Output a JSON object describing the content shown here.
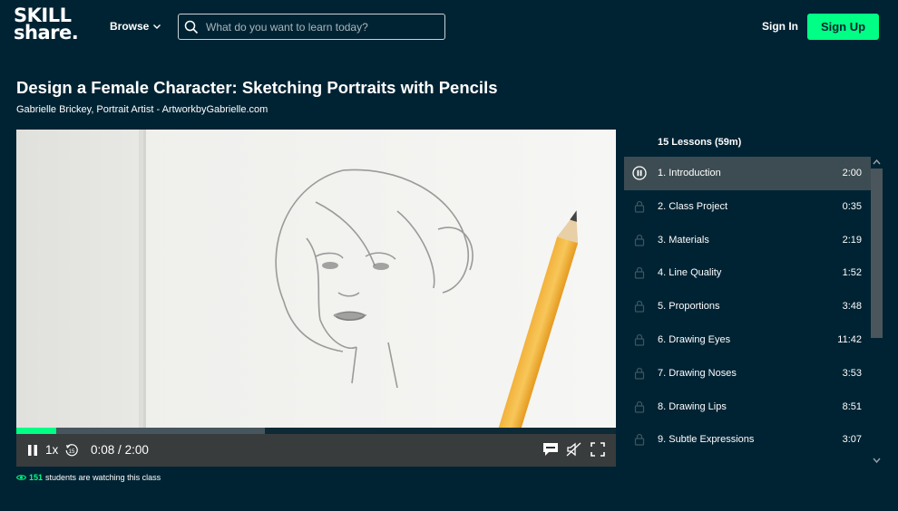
{
  "header": {
    "logo_line1": "SKILL",
    "logo_line2": "share.",
    "browse_label": "Browse",
    "search_placeholder": "What do you want to learn today?",
    "signin_label": "Sign In",
    "signup_label": "Sign Up"
  },
  "course": {
    "title": "Design a Female Character: Sketching Portraits with Pencils",
    "teacher": "Gabrielle Brickey, Portrait Artist - ArtworkbyGabrielle.com"
  },
  "player": {
    "speed": "1x",
    "rewind_seconds": "15",
    "current_time": "0:08",
    "total_time": "2:00",
    "time_separator": "/",
    "progress_fraction": 0.067,
    "buffered_fraction": 0.415
  },
  "lessons": {
    "header": "15 Lessons (59m)",
    "items": [
      {
        "name": "1. Introduction",
        "duration": "2:00",
        "state": "playing"
      },
      {
        "name": "2. Class Project",
        "duration": "0:35",
        "state": "locked"
      },
      {
        "name": "3. Materials",
        "duration": "2:19",
        "state": "locked"
      },
      {
        "name": "4. Line Quality",
        "duration": "1:52",
        "state": "locked"
      },
      {
        "name": "5. Proportions",
        "duration": "3:48",
        "state": "locked"
      },
      {
        "name": "6. Drawing Eyes",
        "duration": "11:42",
        "state": "locked"
      },
      {
        "name": "7. Drawing Noses",
        "duration": "3:53",
        "state": "locked"
      },
      {
        "name": "8. Drawing Lips",
        "duration": "8:51",
        "state": "locked"
      },
      {
        "name": "9. Subtle Expressions",
        "duration": "3:07",
        "state": "locked"
      }
    ]
  },
  "watching": {
    "count": "151",
    "text": "students are watching this class"
  },
  "colors": {
    "background": "#002333",
    "accent": "#00ff84",
    "active_row": "#3d4c52"
  }
}
